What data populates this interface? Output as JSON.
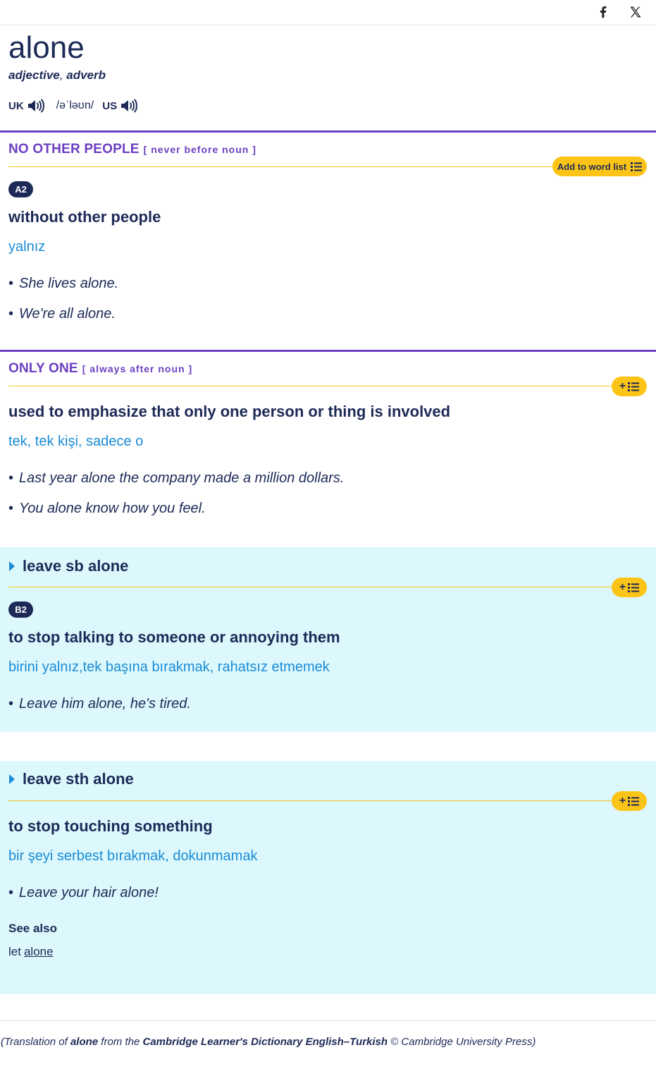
{
  "header": {
    "share_facebook_icon": "facebook-icon",
    "share_x_icon": "x-icon"
  },
  "entry": {
    "headword": "alone",
    "pos_adjective": "adjective",
    "pos_comma": ",",
    "pos_adverb": "adverb",
    "uk_label": "UK",
    "ipa": "/əˈləʊn/",
    "us_label": "US",
    "speaker_icon": "speaker-icon"
  },
  "senses": [
    {
      "guideword": "NO OTHER PEOPLE",
      "grammar": "[ never before noun ]",
      "wordlist_label": "Add to word list",
      "cefr": "A2",
      "definition": "without other people",
      "translation": "yalnız",
      "examples": [
        "She lives alone.",
        "We're all alone."
      ]
    },
    {
      "guideword": "ONLY ONE",
      "grammar": "[ always after noun ]",
      "wordlist_label": "+",
      "definition": "used to emphasize that only one person or thing is involved",
      "translation": "tek, tek kişi, sadece o",
      "examples": [
        "Last year alone the company made a million dollars.",
        "You alone know how you feel."
      ]
    }
  ],
  "idioms": [
    {
      "phrase": "leave sb alone",
      "wordlist_label": "+",
      "cefr": "B2",
      "definition": "to stop talking to someone or annoying them",
      "translation": "birini yalnız,tek başına bırakmak, rahatsız etmemek",
      "examples": [
        "Leave him alone, he's tired."
      ]
    },
    {
      "phrase": "leave sth alone",
      "wordlist_label": "+",
      "definition": "to stop touching something",
      "translation": "bir şeyi serbest bırakmak, dokunmamak",
      "examples": [
        "Leave your hair alone!"
      ],
      "see_also_heading": "See also",
      "see_also_prefix": "let",
      "see_also_link": "alone"
    }
  ],
  "footer": {
    "credit_open": "(Translation of ",
    "credit_word": "alone",
    "credit_mid": " from the ",
    "credit_book": "Cambridge Learner's Dictionary English–Turkish",
    "credit_end": " © Cambridge University Press)"
  },
  "colors": {
    "primary_text": "#1d2a57",
    "sense_purple": "#6c3fc2",
    "translation_blue": "#1a8bd6",
    "wordlist_yellow": "#fbc416",
    "idiom_panel": "#dcf8fc"
  }
}
